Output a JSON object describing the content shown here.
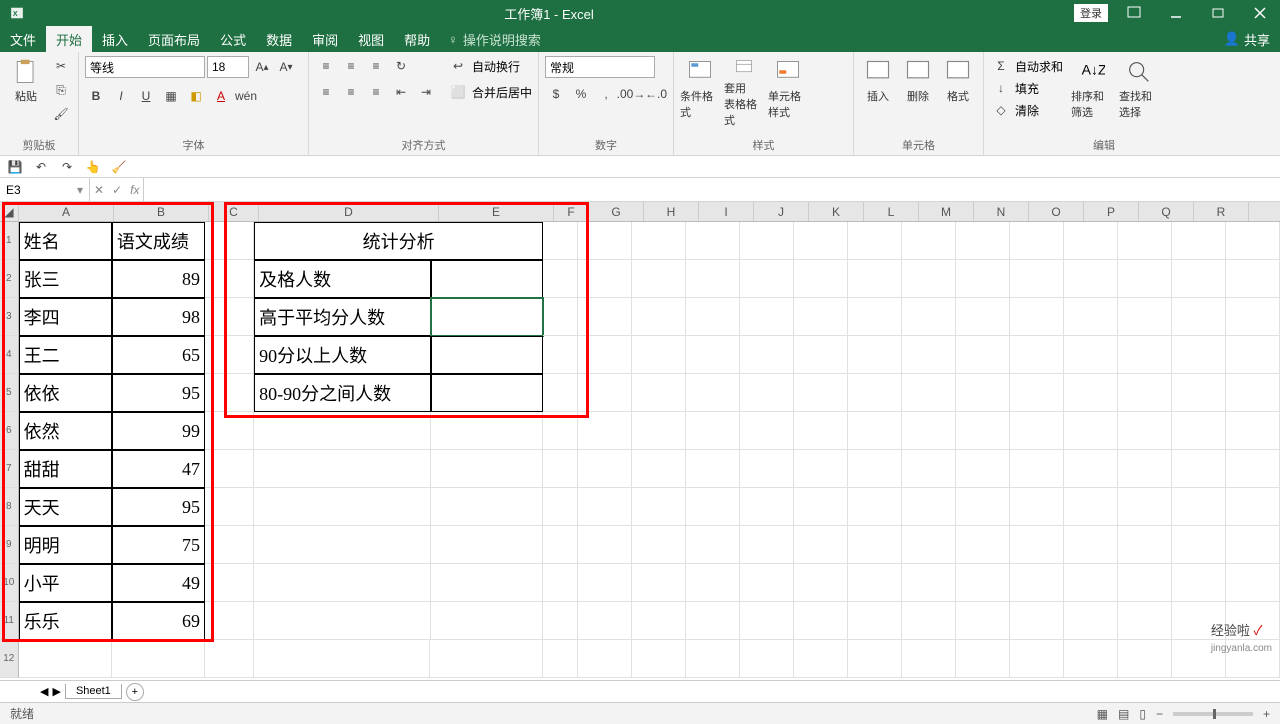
{
  "title_bar": {
    "doc_title": "工作簿1 - Excel",
    "login": "登录"
  },
  "menu": {
    "file": "文件",
    "home": "开始",
    "insert": "插入",
    "page_layout": "页面布局",
    "formulas": "公式",
    "data": "数据",
    "review": "审阅",
    "view": "视图",
    "help": "帮助",
    "tell_me": "操作说明搜索",
    "share": "共享"
  },
  "ribbon": {
    "clipboard": {
      "paste": "粘贴",
      "label": "剪贴板"
    },
    "font": {
      "name": "等线",
      "size": "18",
      "label": "字体"
    },
    "alignment": {
      "wrap": "自动换行",
      "merge": "合并后居中",
      "label": "对齐方式"
    },
    "number": {
      "format": "常规",
      "label": "数字"
    },
    "styles": {
      "cond": "条件格式",
      "table": "套用\n表格格式",
      "cell": "单元格样式",
      "label": "样式"
    },
    "cells": {
      "insert": "插入",
      "delete": "删除",
      "format": "格式",
      "label": "单元格"
    },
    "editing": {
      "sum": "自动求和",
      "fill": "填充",
      "clear": "清除",
      "sort": "排序和筛选",
      "find": "查找和选择",
      "label": "编辑"
    }
  },
  "name_box": "E3",
  "columns": [
    "A",
    "B",
    "C",
    "D",
    "E",
    "F",
    "G",
    "H",
    "I",
    "J",
    "K",
    "L",
    "M",
    "N",
    "O",
    "P",
    "Q",
    "R"
  ],
  "table1": {
    "h1": "姓名",
    "h2": "语文成绩",
    "rows": [
      {
        "n": "张三",
        "s": "89"
      },
      {
        "n": "李四",
        "s": "98"
      },
      {
        "n": "王二",
        "s": "65"
      },
      {
        "n": "依依",
        "s": "95"
      },
      {
        "n": "依然",
        "s": "99"
      },
      {
        "n": "甜甜",
        "s": "47"
      },
      {
        "n": "天天",
        "s": "95"
      },
      {
        "n": "明明",
        "s": "75"
      },
      {
        "n": "小平",
        "s": "49"
      },
      {
        "n": "乐乐",
        "s": "69"
      }
    ]
  },
  "table2": {
    "title": "统计分析",
    "r1": "及格人数",
    "r2": "高于平均分人数",
    "r3": "90分以上人数",
    "r4": "80-90分之间人数"
  },
  "sheet": {
    "name": "Sheet1"
  },
  "status": {
    "ready": "就绪"
  },
  "watermark": {
    "brand": "经验啦",
    "check": "✓",
    "url": "jingyanla.com"
  }
}
